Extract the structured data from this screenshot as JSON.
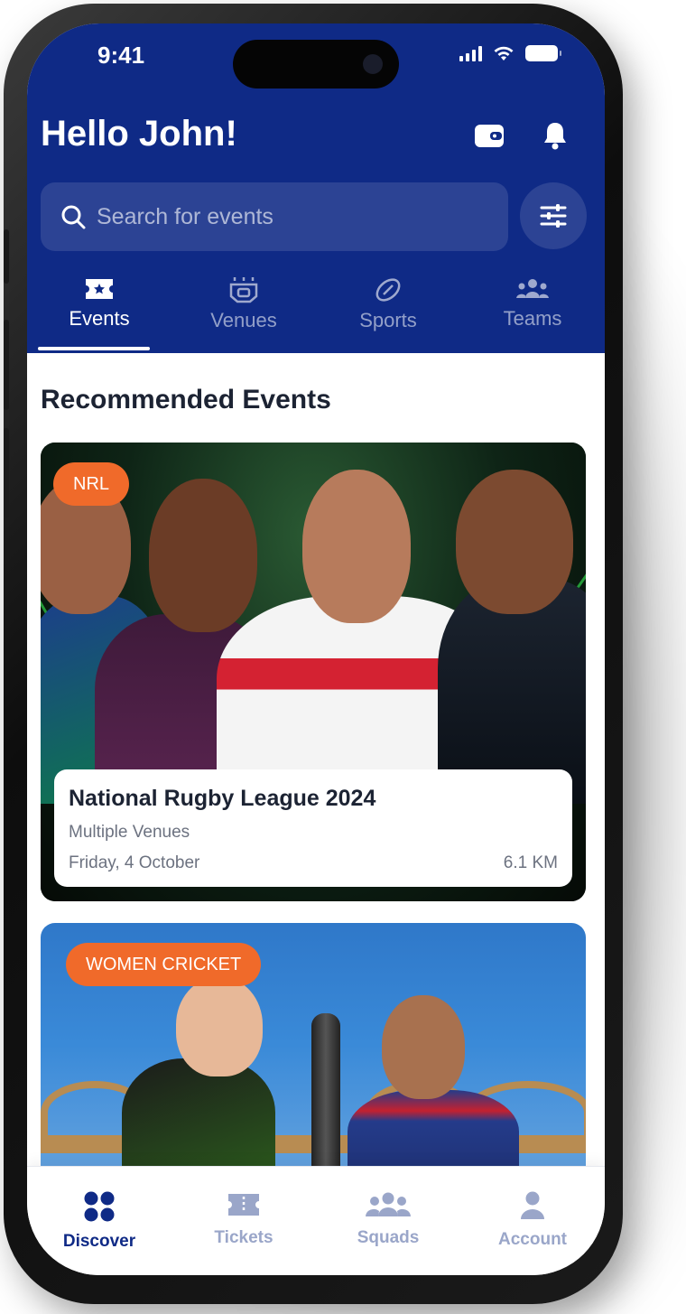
{
  "status_bar": {
    "time": "9:41"
  },
  "header": {
    "greeting": "Hello John!",
    "icons": [
      "wallet-icon",
      "bell-icon"
    ]
  },
  "search": {
    "placeholder": "Search for events",
    "icon": "search-icon",
    "filter_icon": "sliders-icon"
  },
  "tabs": [
    {
      "label": "Events",
      "icon": "ticket-star-icon",
      "active": true
    },
    {
      "label": "Venues",
      "icon": "stadium-icon",
      "active": false
    },
    {
      "label": "Sports",
      "icon": "football-icon",
      "active": false
    },
    {
      "label": "Teams",
      "icon": "team-icon",
      "active": false
    }
  ],
  "recommended": {
    "title": "Recommended Events",
    "events": [
      {
        "badge": "NRL",
        "title": "National Rugby League 2024",
        "venue": "Multiple Venues",
        "date": "Friday, 4 October",
        "distance": "6.1 KM"
      },
      {
        "badge": "WOMEN CRICKET"
      }
    ]
  },
  "bottom_nav": [
    {
      "label": "Discover",
      "icon": "grid-icon",
      "active": true
    },
    {
      "label": "Tickets",
      "icon": "ticket-icon",
      "active": false
    },
    {
      "label": "Squads",
      "icon": "group-icon",
      "active": false
    },
    {
      "label": "Account",
      "icon": "person-icon",
      "active": false
    }
  ],
  "colors": {
    "primary": "#0f2a86",
    "accent": "#f06a2a",
    "nav_inactive": "#9aa6c9"
  }
}
